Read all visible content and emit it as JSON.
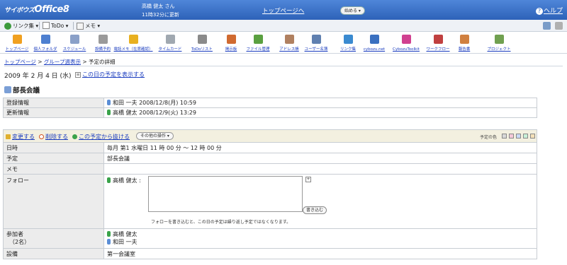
{
  "header": {
    "logo_prefix": "サイボウズ",
    "logo": "Office8",
    "user_name": "高橋 健太 さん",
    "updated": "11時32分に更新",
    "top_link": "トップページへ",
    "start_button": "始める ▾",
    "help": "ヘルプ"
  },
  "menubar": {
    "links": "リンク集 ▾",
    "todo": "ToDo ▾",
    "memo": "メモ ▾"
  },
  "apps": [
    {
      "label": "トップページ",
      "color": "#f0a020"
    },
    {
      "label": "個人フォルダ",
      "color": "#4d7fd0"
    },
    {
      "label": "スケジュール",
      "color": "#8aa0c8"
    },
    {
      "label": "設備予約",
      "color": "#9a9a9a"
    },
    {
      "label": "電話メモ（在席確認）",
      "color": "#e8b020"
    },
    {
      "label": "タイムカード",
      "color": "#a0a8b0"
    },
    {
      "label": "ToDoリスト",
      "color": "#8a8a8a"
    },
    {
      "label": "掲示板",
      "color": "#d06a30"
    },
    {
      "label": "ファイル管理",
      "color": "#5aa040"
    },
    {
      "label": "アドレス帳",
      "color": "#b08060"
    },
    {
      "label": "ユーザー名簿",
      "color": "#6080b0"
    },
    {
      "label": "リンク集",
      "color": "#3a8ad0"
    },
    {
      "label": "cybozu.net",
      "color": "#3a70c0"
    },
    {
      "label": "CybozuToolkit",
      "color": "#d04090"
    },
    {
      "label": "ワークフロー",
      "color": "#c04040"
    },
    {
      "label": "報告書",
      "color": "#d08040"
    },
    {
      "label": "プロジェクト",
      "color": "#70a050"
    }
  ],
  "breadcrumb": {
    "top": "トップページ",
    "sep1": " > ",
    "group": "グループ週表示",
    "sep2": " > ",
    "current": "予定の詳細"
  },
  "date": "2009 年 2 月 4 日 (水)",
  "show_day": "この日の予定を表示する",
  "title": "部長会議",
  "info": {
    "registered_label": "登録情報",
    "registered_value": "和田 一夫 2008/12/8(月) 10:59",
    "updated_label": "更新情報",
    "updated_value": "高橋 健太 2008/12/9(火) 13:29"
  },
  "actions": {
    "edit": "変更する",
    "delete": "削除する",
    "leave": "この予定から抜ける",
    "other": "その他の操作 ▾",
    "color_label": "予定の色",
    "colors": [
      "#d8d8d8",
      "#f4c8d8",
      "#c8d8f4",
      "#c8f0d8",
      "#f4e0b8"
    ]
  },
  "detail": {
    "datetime_label": "日時",
    "datetime_value": "毎月 第1 水曜日 11 時 00 分 ～ 12 時 00 分",
    "schedule_label": "予定",
    "schedule_value": "部長会議",
    "memo_label": "メモ",
    "memo_value": "",
    "follow_label": "フォロー",
    "follow_user": "高橋 健太 :",
    "follow_button": "書き込む",
    "follow_expand": "+",
    "follow_note": "フォローを書き込むと、この日の予定は繰り返し予定ではなくなります。",
    "participants_label": "参加者",
    "participants_count": "（2名）",
    "participants": [
      "高橋 健太",
      "和田 一夫"
    ],
    "facility_label": "設備",
    "facility_value": "第一会議室"
  }
}
